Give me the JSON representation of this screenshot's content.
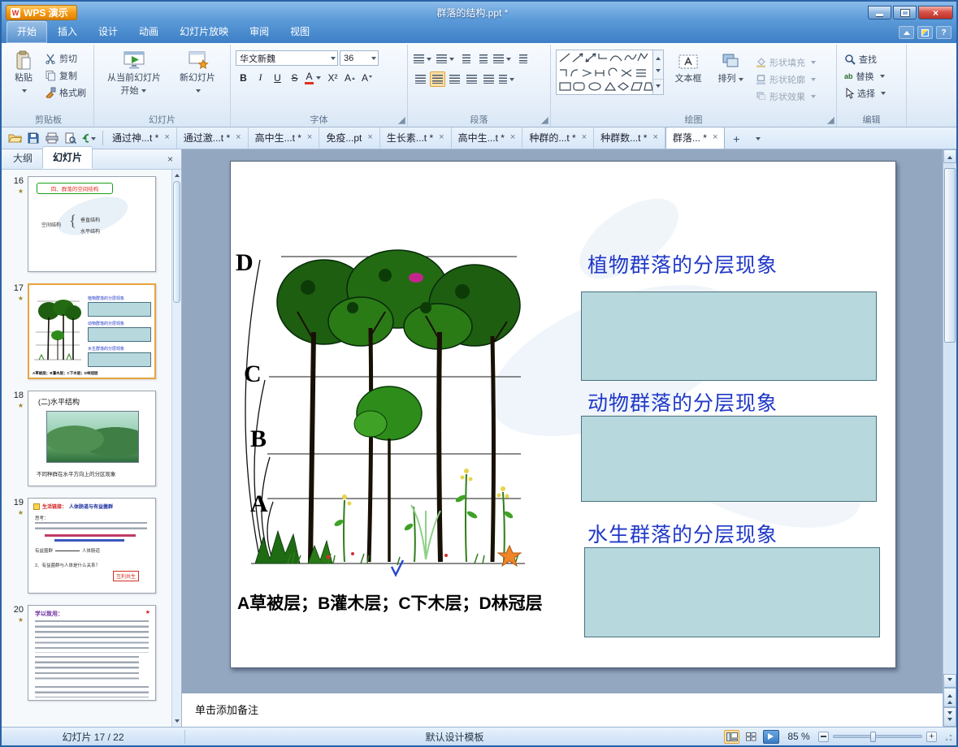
{
  "icons": {
    "wps_logo": "W",
    "close_x": "×",
    "plus": "+",
    "help": "?",
    "anim_star": "★",
    "brace": "{",
    "superscript": "X²",
    "ab": "ab"
  },
  "window": {
    "app_button": "WPS 演示",
    "title": "群落的结构.ppt *"
  },
  "ribbon_tabs": {
    "home": "开始",
    "insert": "插入",
    "design": "设计",
    "animation": "动画",
    "slideshow": "幻灯片放映",
    "review": "审阅",
    "view": "视图"
  },
  "ribbon": {
    "clipboard": {
      "label": "剪贴板",
      "paste": "粘贴",
      "cut": "剪切",
      "copy": "复制",
      "format_painter": "格式刷"
    },
    "slides": {
      "label": "幻灯片",
      "from_current_line1": "从当前幻灯片",
      "from_current_line2": "开始",
      "new_slide": "新幻灯片"
    },
    "font": {
      "label": "字体",
      "name": "华文新魏",
      "size": "36",
      "bold": "B",
      "italic": "I",
      "underline": "U",
      "strike": "S",
      "color_letter": "A"
    },
    "paragraph": {
      "label": "段落"
    },
    "drawing": {
      "label": "绘图",
      "text_box": "文本框",
      "arrange": "排列",
      "shape_fill": "形状填充",
      "shape_outline": "形状轮廓",
      "shape_effects": "形状效果"
    },
    "editing": {
      "label": "编辑",
      "find": "查找",
      "replace": "替换",
      "select": "选择"
    }
  },
  "doc_bar": {
    "tabs": [
      {
        "label": "通过神...t *"
      },
      {
        "label": "通过激...t *"
      },
      {
        "label": "高中生...t *"
      },
      {
        "label": "免疫...pt"
      },
      {
        "label": "生长素...t *"
      },
      {
        "label": "高中生...t *"
      },
      {
        "label": "种群的...t *"
      },
      {
        "label": "种群数...t *"
      },
      {
        "label": "群落... *"
      }
    ]
  },
  "sidebar": {
    "outline_tab": "大纲",
    "slides_tab": "幻灯片"
  },
  "thumbnails": [
    {
      "number": "16",
      "box_title": "四、群落的空间结构",
      "node": "空间结构",
      "branch_top": "垂直结构",
      "branch_bottom": "水平结构"
    },
    {
      "number": "17"
    },
    {
      "number": "18",
      "title": "(二)水平结构",
      "caption": "不同种群在水平方向上的分区现象"
    },
    {
      "number": "19",
      "tag": "生活链接：",
      "title": "人体肠道与有益菌群",
      "think": "思考：",
      "rel_left": "有益菌群",
      "rel_right": "人体肠道",
      "q2": "2、有益菌群与人体是什么关系？",
      "answer": "互利共生"
    },
    {
      "number": "20",
      "title": "学以致用："
    }
  ],
  "slide": {
    "headings": [
      "植物群落的分层现象",
      "动物群落的分层现象",
      "水生群落的分层现象"
    ],
    "layers": [
      "D",
      "C",
      "B",
      "A"
    ],
    "caption": "A草被层；B灌木层；C下木层；D林冠层"
  },
  "notes": {
    "placeholder": "单击添加备注"
  },
  "status_bar": {
    "slide_counter": "幻灯片 17 / 22",
    "template_name": "默认设计模板",
    "zoom_level": "85 %"
  }
}
